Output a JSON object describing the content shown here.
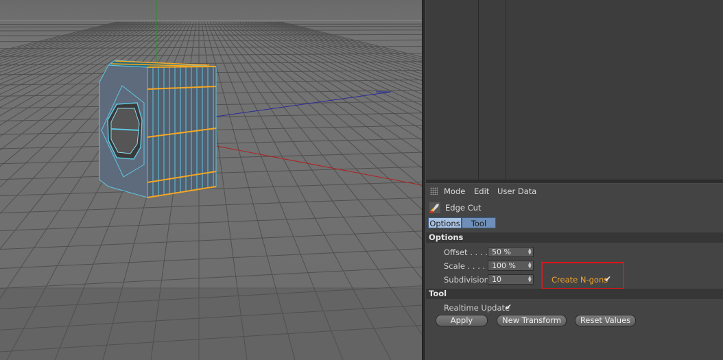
{
  "attribute_manager": {
    "menu": [
      "Mode",
      "Edit",
      "User Data"
    ],
    "tool_name": "Edge Cut",
    "tabs": [
      "Options",
      "Tool"
    ],
    "sections": {
      "options": "Options",
      "tool": "Tool"
    },
    "params": {
      "offset": {
        "label": "Offset . . . .",
        "value": "50 %"
      },
      "scale": {
        "label": "Scale . . . . .",
        "value": "100 %"
      },
      "subdivision": {
        "label": "Subdivision",
        "value": "10"
      },
      "create_ngons": {
        "label": "Create N-gons",
        "checked": true
      },
      "realtime_update": {
        "label": "Realtime Update",
        "checked": true
      }
    },
    "buttons": {
      "apply": "Apply",
      "new_transform": "New Transform",
      "reset_values": "Reset Values"
    },
    "check_glyph": "✔"
  },
  "colors": {
    "highlight_box": "#e0141a",
    "ngons_label": "#f2a22a",
    "selected_edges": "#f5a623",
    "mesh_wire": "#5fc6e0"
  }
}
